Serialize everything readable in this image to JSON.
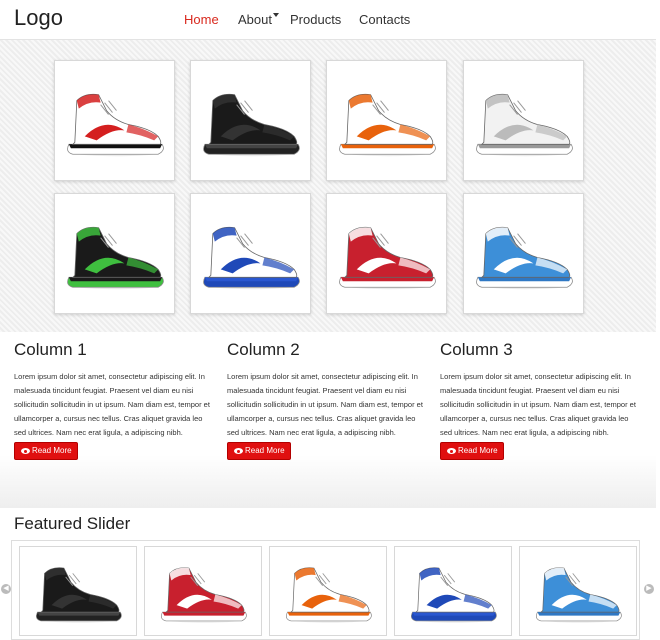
{
  "header": {
    "logo": "Logo",
    "nav": [
      {
        "label": "Home",
        "active": true
      },
      {
        "label": "About",
        "active": false,
        "dropdown": true
      },
      {
        "label": "Products",
        "active": false
      },
      {
        "label": "Contacts",
        "active": false
      }
    ]
  },
  "gallery": {
    "items": [
      {
        "name": "white-red-stripe-high-top",
        "upper": "#ffffff",
        "accent": "#d41f1f",
        "sole": "#ffffff",
        "foxing": "#111111"
      },
      {
        "name": "black-high-top",
        "upper": "#1a1a1a",
        "accent": "#333333",
        "sole": "#222222",
        "foxing": "#444444"
      },
      {
        "name": "orange-white-high-top",
        "upper": "#ffffff",
        "accent": "#e8620c",
        "sole": "#ffffff",
        "foxing": "#e8620c"
      },
      {
        "name": "white-strap-high-top",
        "upper": "#f2f2f2",
        "accent": "#bbbbbb",
        "sole": "#ffffff",
        "foxing": "#999999"
      },
      {
        "name": "black-green-high-top",
        "upper": "#1a1a1a",
        "accent": "#3fbf3f",
        "sole": "#3fbf3f",
        "foxing": "#1a1a1a"
      },
      {
        "name": "white-blue-basketball",
        "upper": "#ffffff",
        "accent": "#1f49b8",
        "sole": "#1f49b8",
        "foxing": "#2a57d0"
      },
      {
        "name": "red-white-high-top",
        "upper": "#c8202e",
        "accent": "#ffffff",
        "sole": "#ffffff",
        "foxing": "#c8202e"
      },
      {
        "name": "blue-white-high-top",
        "upper": "#3d8fd8",
        "accent": "#ffffff",
        "sole": "#ffffff",
        "foxing": "#2f78c4"
      }
    ]
  },
  "columns": [
    {
      "title": "Column 1",
      "text": "Lorem ipsum dolor sit amet, consectetur adipiscing elit. In malesuada tincidunt feugiat. Praesent vel diam eu nisi sollicitudin sollicitudin in ut ipsum. Nam diam est, tempor et ullamcorper a, cursus nec tellus. Cras aliquet gravida leo sed ultrices. Nam nec erat ligula, a adipiscing nibh.",
      "button": "Read More"
    },
    {
      "title": "Column 2",
      "text": "Lorem ipsum dolor sit amet, consectetur adipiscing elit. In malesuada tincidunt feugiat. Praesent vel diam eu nisi sollicitudin sollicitudin in ut ipsum. Nam diam est, tempor et ullamcorper a, cursus nec tellus. Cras aliquet gravida leo sed ultrices. Nam nec erat ligula, a adipiscing nibh.",
      "button": "Read More"
    },
    {
      "title": "Column 3",
      "text": "Lorem ipsum dolor sit amet, consectetur adipiscing elit. In malesuada tincidunt feugiat. Praesent vel diam eu nisi sollicitudin sollicitudin in ut ipsum. Nam diam est, tempor et ullamcorper a, cursus nec tellus. Cras aliquet gravida leo sed ultrices. Nam nec erat ligula, a adipiscing nibh.",
      "button": "Read More"
    }
  ],
  "featured": {
    "title": "Featured Slider",
    "prev_icon": "chevron-left-icon",
    "next_icon": "chevron-right-icon",
    "slides": [
      1,
      6,
      2,
      5,
      7
    ]
  },
  "colors": {
    "accent": "#d9291e",
    "button": "#e01010"
  }
}
